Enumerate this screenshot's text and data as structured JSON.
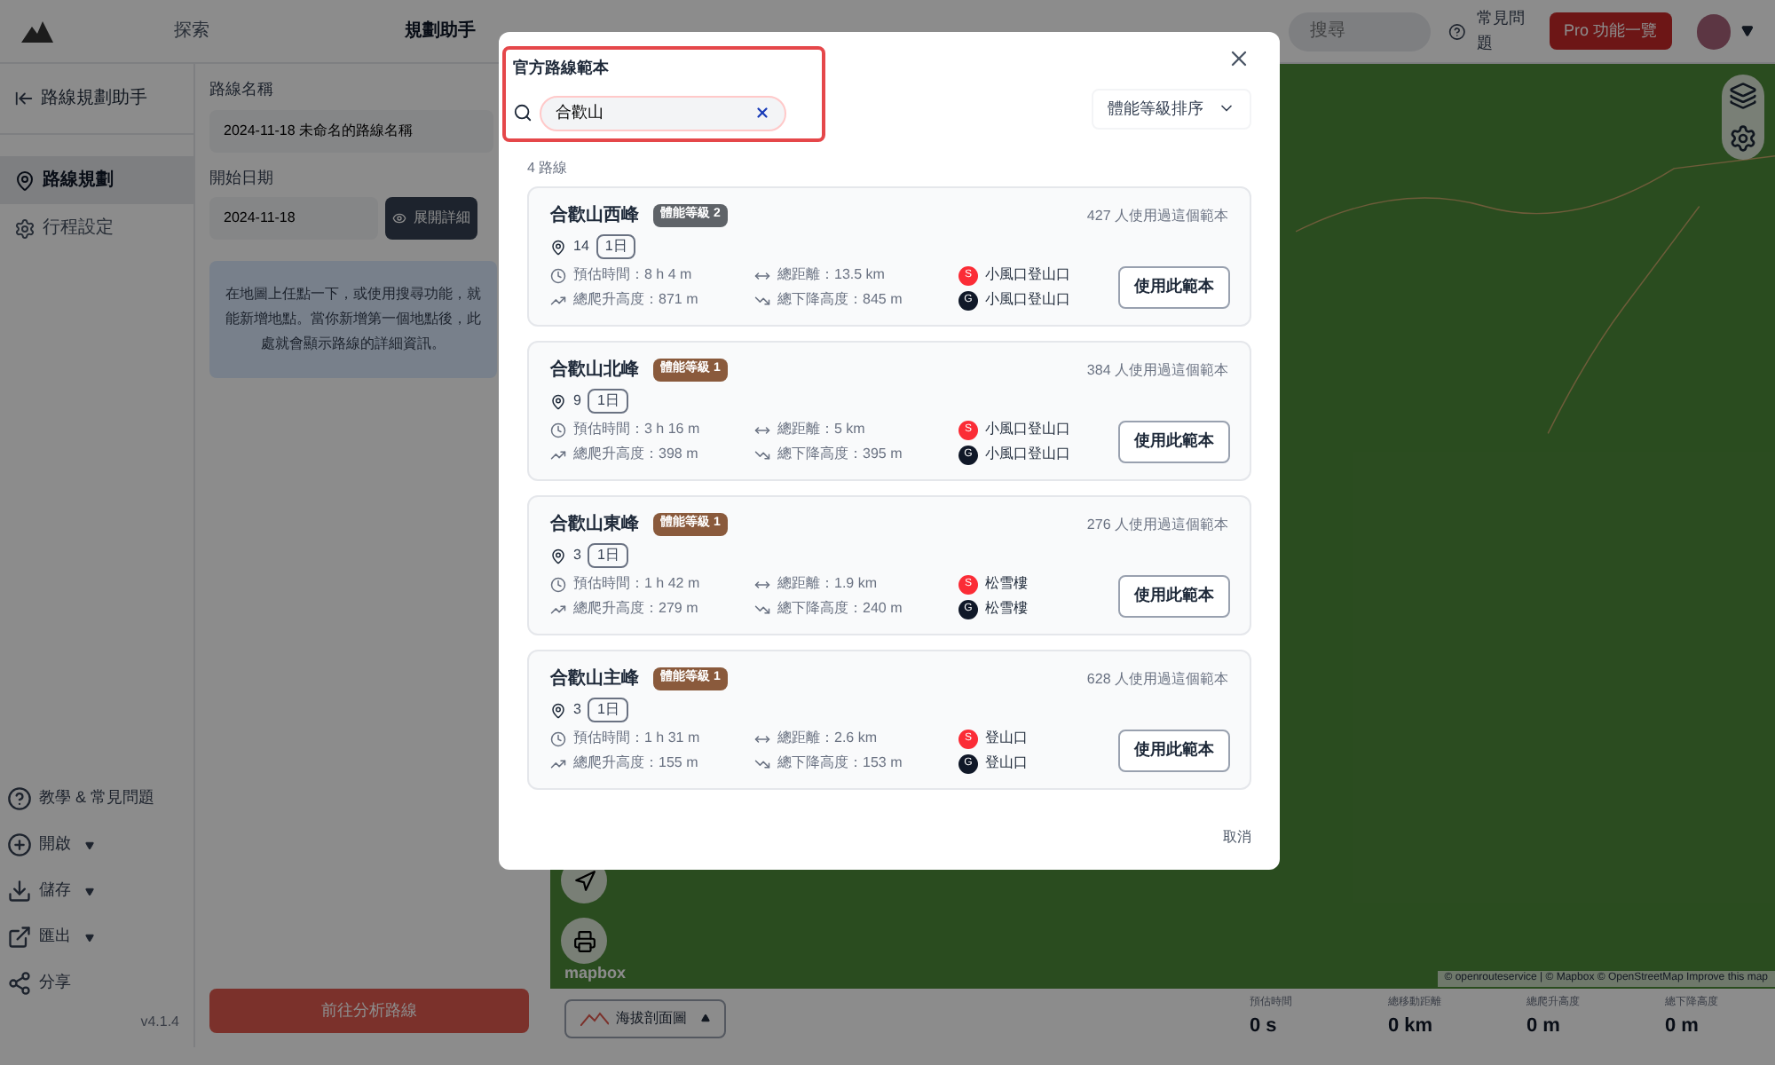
{
  "header": {
    "nav": [
      {
        "label": "探索",
        "selected": false
      },
      {
        "label": "規劃助手",
        "selected": true
      }
    ],
    "search": {
      "placeholder": "搜尋"
    },
    "faq": "常見問題",
    "pro": "Pro 功能一覽"
  },
  "sidebar": {
    "back": "路線規劃助手",
    "items": [
      {
        "label": "路線規劃",
        "selected": true
      },
      {
        "label": "行程設定",
        "selected": false
      }
    ],
    "bottom_items": [
      {
        "kind": "help",
        "label": "教學 & 常見問題",
        "dropdown": false
      },
      {
        "kind": "open",
        "label": "開啟",
        "dropdown": true
      },
      {
        "kind": "save",
        "label": "儲存",
        "dropdown": true
      },
      {
        "kind": "export",
        "label": "匯出",
        "dropdown": true
      },
      {
        "kind": "share",
        "label": "分享",
        "dropdown": false
      }
    ],
    "version": "v4.1.4"
  },
  "form": {
    "name_label": "路線名稱",
    "name_value": "2024-11-18 未命名的路線名稱",
    "date_label": "開始日期",
    "date_value": "2024-11-18",
    "expand_button": "展開詳細",
    "hint": "在地圖上任點一下，或使用搜尋功能，就能新增地點。當你新增第一個地點後，此處就會顯示路線的詳細資訊。",
    "analyze_button": "前往分析路線"
  },
  "map": {
    "brand": "mapbox",
    "attribution": "© openrouteservice | © Mapbox © OpenStreetMap Improve this map",
    "profile_button": "海拔剖面圖",
    "stats": [
      {
        "label": "預估時間",
        "value": "0 s"
      },
      {
        "label": "總移動距離",
        "value": "0 km"
      },
      {
        "label": "總爬升高度",
        "value": "0 m"
      },
      {
        "label": "總下降高度",
        "value": "0 m"
      }
    ]
  },
  "modal": {
    "title": "官方路線範本",
    "search": {
      "value": "合歡山"
    },
    "sort": "體能等級排序",
    "count": "4 路線",
    "cancel": "取消",
    "routes": [
      {
        "name": "合歡山西峰",
        "level": "體能等級 2",
        "color": "#5f6368",
        "points": "14",
        "days": "1日",
        "usage": "427 人使用過這個範本",
        "time": "預估時間：8 h 4 m",
        "distance": "總距離：13.5 km",
        "ascent": "總爬升高度：871 m",
        "descent": "總下降高度：845 m",
        "start_badge": "S",
        "start": "小風口登山口",
        "end_badge": "G",
        "end": "小風口登山口",
        "button": "使用此範本"
      },
      {
        "name": "合歡山北峰",
        "level": "體能等級 1",
        "color": "#8a5a3c",
        "points": "9",
        "days": "1日",
        "usage": "384 人使用過這個範本",
        "time": "預估時間：3 h 16 m",
        "distance": "總距離：5 km",
        "ascent": "總爬升高度：398 m",
        "descent": "總下降高度：395 m",
        "start_badge": "S",
        "start": "小風口登山口",
        "end_badge": "G",
        "end": "小風口登山口",
        "button": "使用此範本"
      },
      {
        "name": "合歡山東峰",
        "level": "體能等級 1",
        "color": "#8a5a3c",
        "points": "3",
        "days": "1日",
        "usage": "276 人使用過這個範本",
        "time": "預估時間：1 h 42 m",
        "distance": "總距離：1.9 km",
        "ascent": "總爬升高度：279 m",
        "descent": "總下降高度：240 m",
        "start_badge": "S",
        "start": "松雪樓",
        "end_badge": "G",
        "end": "松雪樓",
        "button": "使用此範本"
      },
      {
        "name": "合歡山主峰",
        "level": "體能等級 1",
        "color": "#8a5a3c",
        "points": "3",
        "days": "1日",
        "usage": "628 人使用過這個範本",
        "time": "預估時間：1 h 31 m",
        "distance": "總距離：2.6 km",
        "ascent": "總爬升高度：155 m",
        "descent": "總下降高度：153 m",
        "start_badge": "S",
        "start": "登山口",
        "end_badge": "G",
        "end": "登山口",
        "button": "使用此範本"
      }
    ]
  }
}
